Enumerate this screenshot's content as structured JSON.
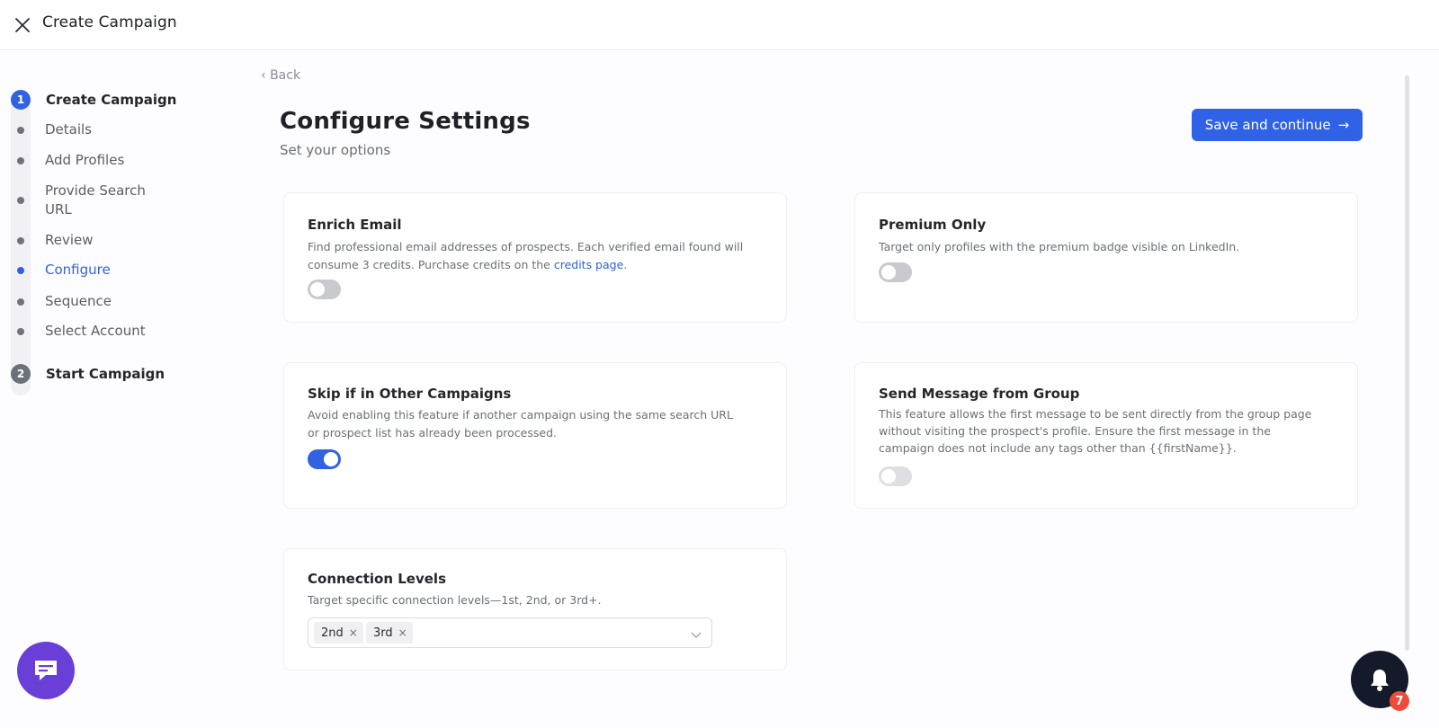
{
  "header": {
    "title": "Create Campaign"
  },
  "stepper": {
    "step1": {
      "number": "1",
      "label": "Create Campaign"
    },
    "items": [
      {
        "label": "Details"
      },
      {
        "label": "Add Profiles"
      },
      {
        "label": "Provide Search URL"
      },
      {
        "label": "Review"
      },
      {
        "label": "Configure"
      },
      {
        "label": "Sequence"
      },
      {
        "label": "Select Account"
      }
    ],
    "active_item": "Configure",
    "step2": {
      "number": "2",
      "label": "Start Campaign"
    }
  },
  "main": {
    "back_label": "Back",
    "title": "Configure Settings",
    "subtitle": "Set your options",
    "save_label": "Save and continue",
    "save_arrow": "→"
  },
  "cards": {
    "enrich_email": {
      "title": "Enrich Email",
      "desc_line1": "Find professional email addresses of prospects. Each verified email found will",
      "desc_line2": "consume 3 credits. Purchase credits on the ",
      "desc_link": "credits page",
      "desc_end": ".",
      "enabled": false
    },
    "premium_only": {
      "title": "Premium Only",
      "desc": "Target only profiles with the premium badge visible on LinkedIn.",
      "enabled": false
    },
    "skip_other": {
      "title": "Skip if in Other Campaigns",
      "desc_line1": "Avoid enabling this feature if another campaign using the same search URL",
      "desc_line2": "or prospect list has already been processed.",
      "enabled": true
    },
    "send_group": {
      "title": "Send Message from Group",
      "desc_line1": "This feature allows the first message to be sent directly from the group page",
      "desc_line2": "without visiting the prospect's profile. Ensure the first message in the",
      "desc_line3": "campaign does not include any tags other than {{firstName}}.",
      "enabled": false
    },
    "connection_levels": {
      "title": "Connection Levels",
      "desc": "Target specific connection levels—1st, 2nd, or 3rd+.",
      "selected": [
        "2nd",
        "3rd"
      ],
      "remove_glyph": "×"
    }
  },
  "notifications": {
    "count": "7"
  },
  "colors": {
    "accent": "#3362e0",
    "chat": "#6a3fd8",
    "badge": "#ef4b3a"
  }
}
